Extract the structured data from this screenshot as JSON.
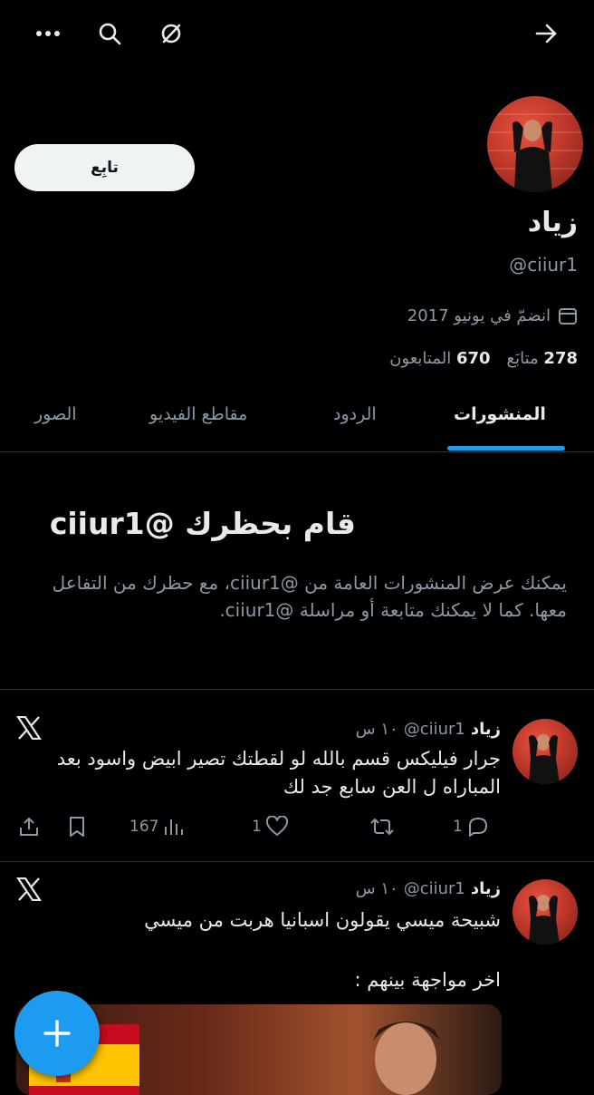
{
  "topbar": {
    "icons": [
      "more-icon",
      "search-icon",
      "no-sync-icon",
      "forward-arrow-icon"
    ]
  },
  "profile": {
    "follow_label": "تابِع",
    "name": "زياد",
    "handle": "@ciiur1",
    "joined": "انضمّ في يونيو 2017",
    "following_count": "278",
    "following_label": "متابَع",
    "followers_count": "670",
    "followers_label": "المتابعون"
  },
  "tabs": [
    "المنشورات",
    "الردود",
    "مقاطع الفيديو",
    "الصور"
  ],
  "blocked": {
    "title": "قام بحظرك @ciiur1",
    "body": "يمكنك عرض المنشورات العامة من @ciiur1، مع حظرك من التفاعل معها. كما لا يمكنك متابعة أو مراسلة @ciiur1."
  },
  "posts": [
    {
      "name": "زياد",
      "handle": "@ciiur1",
      "time": "١٠ س",
      "text": "جرار فيليكس قسم بالله لو لقطتك تصير ابيض واسود بعد المباراه ل العن سابع جد لك",
      "replies": "1",
      "reposts": "",
      "likes": "1",
      "views": "167"
    },
    {
      "name": "زياد",
      "handle": "@ciiur1",
      "time": "١٠ س",
      "text_line1": "شبيحة ميسي يقولون اسبانيا هربت من ميسي",
      "text_line2": "اخر مواجهة بينهم :"
    }
  ],
  "colors": {
    "accent": "#1d9bf0",
    "background": "#000000",
    "secondary_text": "#8b98a5"
  }
}
